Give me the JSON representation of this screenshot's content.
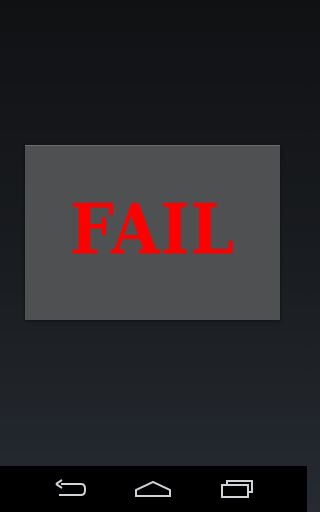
{
  "dialog": {
    "text": "FAIL",
    "text_color": "#ff0000",
    "background": "#4e5052"
  },
  "navbar": {
    "buttons": [
      {
        "name": "back",
        "icon": "back-arrow-icon"
      },
      {
        "name": "home",
        "icon": "home-icon"
      },
      {
        "name": "recents",
        "icon": "recent-apps-icon"
      }
    ]
  }
}
